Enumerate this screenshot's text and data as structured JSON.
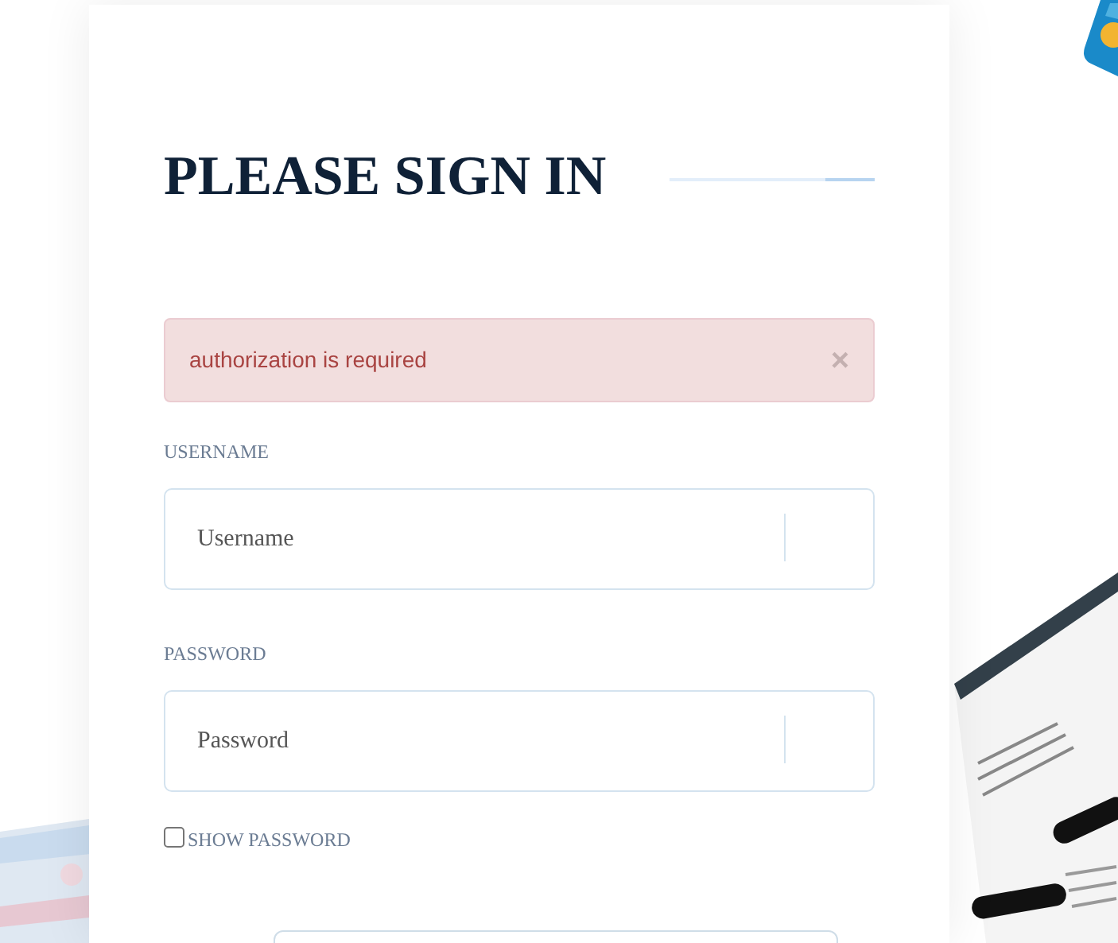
{
  "title": "PLEASE SIGN IN",
  "alert": {
    "message": "authorization is required",
    "close": "×"
  },
  "fields": [
    {
      "label": "USERNAME",
      "placeholder": "Username"
    },
    {
      "label": "PASSWORD",
      "placeholder": "Password"
    }
  ],
  "show_password": {
    "label": "SHOW PASSWORD",
    "checked": false
  }
}
